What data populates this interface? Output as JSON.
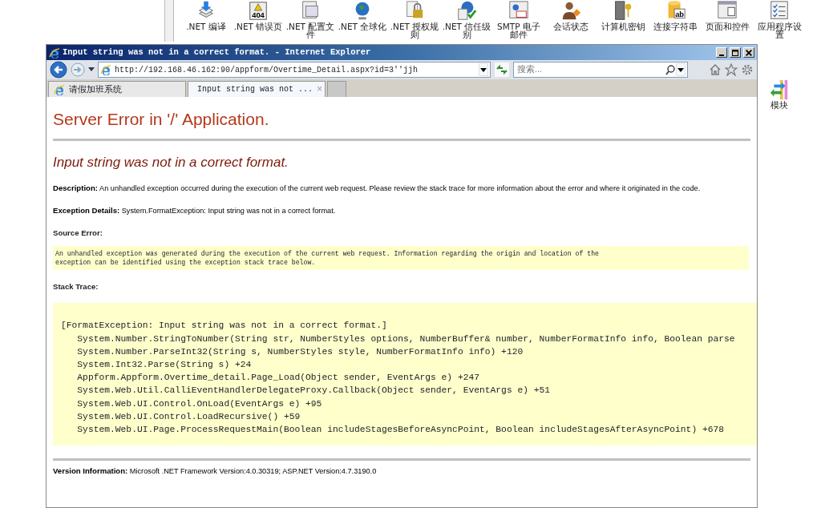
{
  "background_window": {
    "features": [
      {
        "label": ".NET 编译"
      },
      {
        "label": ".NET 错误页",
        "icon_text": "404"
      },
      {
        "label": ".NET 配置文件"
      },
      {
        "label": ".NET 全球化"
      },
      {
        "label": ".NET 授权规则"
      },
      {
        "label": ".NET 信任级别"
      },
      {
        "label": "SMTP 电子邮件"
      },
      {
        "label": "会话状态"
      },
      {
        "label": "计算机密钥"
      },
      {
        "label": "连接字符串",
        "icon_text": "ab"
      },
      {
        "label": "页面和控件"
      },
      {
        "label": "应用程序设置"
      }
    ],
    "side_feature": {
      "label": "模块"
    }
  },
  "browser": {
    "title": "Input string was not in a correct format. - Internet Explorer",
    "address": "http://192.168.46.162:90/appform/Overtime_Detail.aspx?id=3''jjh",
    "search": {
      "placeholder": "搜索..."
    },
    "tabs": [
      {
        "label": "请假加班系统",
        "selected": false
      },
      {
        "label": "Input string was not ...",
        "selected": true,
        "close": "×"
      }
    ]
  },
  "page": {
    "heading": "Server Error in '/' Application.",
    "error_title": "Input string was not in a correct format.",
    "description": {
      "label": "Description:",
      "text": "An unhandled exception occurred during the execution of the current web request. Please review the stack trace for more information about the error and where it originated in the code."
    },
    "exception_details": {
      "label": "Exception Details:",
      "text": "System.FormatException: Input string was not in a correct format."
    },
    "source_error": {
      "label": "Source Error:",
      "lines": [
        "An unhandled exception was generated during the execution of the current web request. Information regarding the origin and location of the",
        "exception can be identified using the exception stack trace below."
      ]
    },
    "stack_trace": {
      "label": "Stack Trace:",
      "lines": [
        "[FormatException: Input string was not in a correct format.]",
        "   System.Number.StringToNumber(String str, NumberStyles options, NumberBuffer& number, NumberFormatInfo info, Boolean parse",
        "   System.Number.ParseInt32(String s, NumberStyles style, NumberFormatInfo info) +120",
        "   System.Int32.Parse(String s) +24",
        "   Appform.Appform.Overtime_detail.Page_Load(Object sender, EventArgs e) +247",
        "   System.Web.Util.CalliEventHandlerDelegateProxy.Callback(Object sender, EventArgs e) +51",
        "   System.Web.UI.Control.OnLoad(EventArgs e) +95",
        "   System.Web.UI.Control.LoadRecursive() +59",
        "   System.Web.UI.Page.ProcessRequestMain(Boolean includeStagesBeforeAsyncPoint, Boolean includeStagesAfterAsyncPoint) +678"
      ]
    },
    "version": {
      "label": "Version Information:",
      "text": "Microsoft .NET Framework Version:4.0.30319; ASP.NET Version:4.7.3190.0"
    }
  }
}
